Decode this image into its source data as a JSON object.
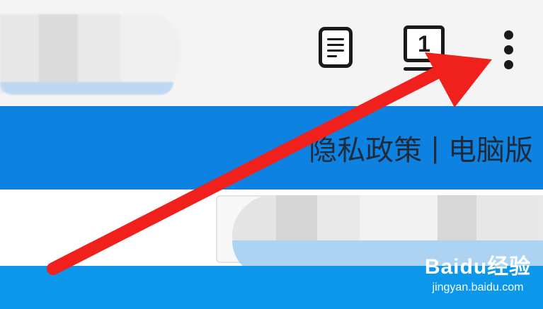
{
  "toolbar": {
    "tab_count": "1",
    "icons": [
      "reader-mode-icon",
      "tabs-icon",
      "more-options-icon"
    ]
  },
  "header_links": {
    "privacy": "隐私政策",
    "separator": "|",
    "desktop": "电脑版"
  },
  "watermark": {
    "logo": "Baidu经验",
    "url": "jingyan.baidu.com"
  },
  "colors": {
    "header_blue": "#0d82e0",
    "footer_blue": "#0c97ea",
    "arrow_red": "#f0201c"
  }
}
